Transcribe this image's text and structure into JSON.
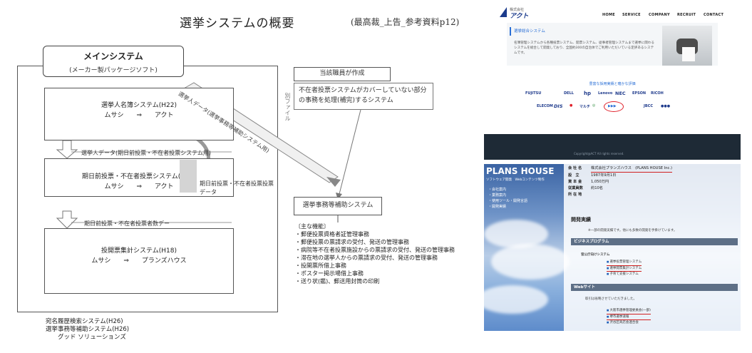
{
  "document": {
    "title": "選挙システムの概要",
    "reference": "(最高裁_上告_参考資料p12)",
    "main_system": {
      "name": "メインシステム",
      "subtitle": "(メーカー製パッケージソフト)"
    },
    "diagonal_label": "選挙人データ(選挙事務等補助システム用)",
    "systems": [
      {
        "name": "選挙人名簿システム(H22)",
        "vendors": "ムサシ　　⇒　　アクト"
      },
      {
        "name": "期日前投票・不在者投票システム(H13)",
        "vendors": "ムサシ　　⇒　　アクト"
      },
      {
        "name": "投開票集計システム(H18)",
        "vendors": "ムサシ　　⇒　　プランズハウス"
      }
    ],
    "flow_labels": [
      "選挙人データ(期日前投票・不在者投票システム用)",
      "期日前投票・不在者投票者数デー"
    ],
    "side_data_label": "期日前投票・不在者投票投票データ",
    "vertical_note": "別ファイル",
    "staff_box": "当該職員が作成",
    "staff_desc": "不在者投票システムがカバーしていない部分の事務を処理(補完)するシステム",
    "support_system": "選挙事務等補助システム",
    "features": [
      "〔主な機能〕",
      "・郵便投票資格者証管理事務",
      "・郵便投票の票請求の受付、発送の管理事務",
      "・病院等不在者投票施設からの票請求の受付、発送の管理事務",
      "・滞在地の選挙人からの票請求の受付、発送の管理事務",
      "・投開票所借上事務",
      "・ポスター掲示場借上事務",
      "・送り状(鑑)、郵送用封筒の印刷"
    ],
    "bottom_notes": [
      "宛名履歴検索システム(H26)",
      "選挙事務等補助システム(H26)",
      "　　グッド ソリューションズ"
    ]
  },
  "act_site": {
    "logo_small": "株式会社",
    "logo_brand": "アクト",
    "menu": [
      "HOME",
      "SERVICE",
      "COMPANY",
      "RECRUIT",
      "CONTACT"
    ],
    "hero_title": "選挙総合システム",
    "hero_text": "名簿管理システムから各種投票システム、開票システム、従事者管理システムまで選挙に関わるシステムを総合して開発しており、全国約300の自治体でご利用いただいている定評あるシステムです。",
    "sub_title": "豊富な採用実績と確かな評価",
    "partner_logos": [
      "FUJITSU",
      "DELL",
      "hp",
      "Lenovo",
      "NEC",
      "EPSON",
      "RICOH",
      "ELECOM",
      "DIS",
      "●",
      "マルチ",
      "◎",
      "▶▶▶",
      "JBCC",
      "●●●"
    ],
    "copyright": "Copyright@ACT All rights reserved."
  },
  "plans_site": {
    "brand": "PLANS HOUSE",
    "tagline": "ソフトウェア開発　Webコンテンツ制作",
    "nav": [
      "・会社案内",
      "・業務案内",
      "・使用ツール・開発言語",
      "・開発実績"
    ],
    "info": [
      {
        "k": "会 社 名",
        "v": "株式会社プランズハウス　(PLANS HOUSE Inc.)"
      },
      {
        "k": "設　立",
        "v": "1987年9月1日"
      },
      {
        "k": "資 本 金",
        "v": "1,050万円"
      },
      {
        "k": "従業員数",
        "v": "約10名"
      },
      {
        "k": "所 在 地",
        "v": ""
      }
    ],
    "section_title": "開発実績",
    "section_note": "※一部の開発実績です。他にも多数の開発を手掛けています。",
    "bar_business": "ビジネスプログラム",
    "gov_title": "官公庁向けシステム",
    "gov_items": [
      "選挙投票管理システム",
      "選挙開票集計システム",
      "子育て支援システム"
    ],
    "bar_web": "Webサイト",
    "web_note": "取引は省略させていただきました。",
    "web_items": [
      "大阪市選挙管理委員会(一部)",
      "堺市選挙速報",
      "渋谷区商店会連合会"
    ]
  }
}
